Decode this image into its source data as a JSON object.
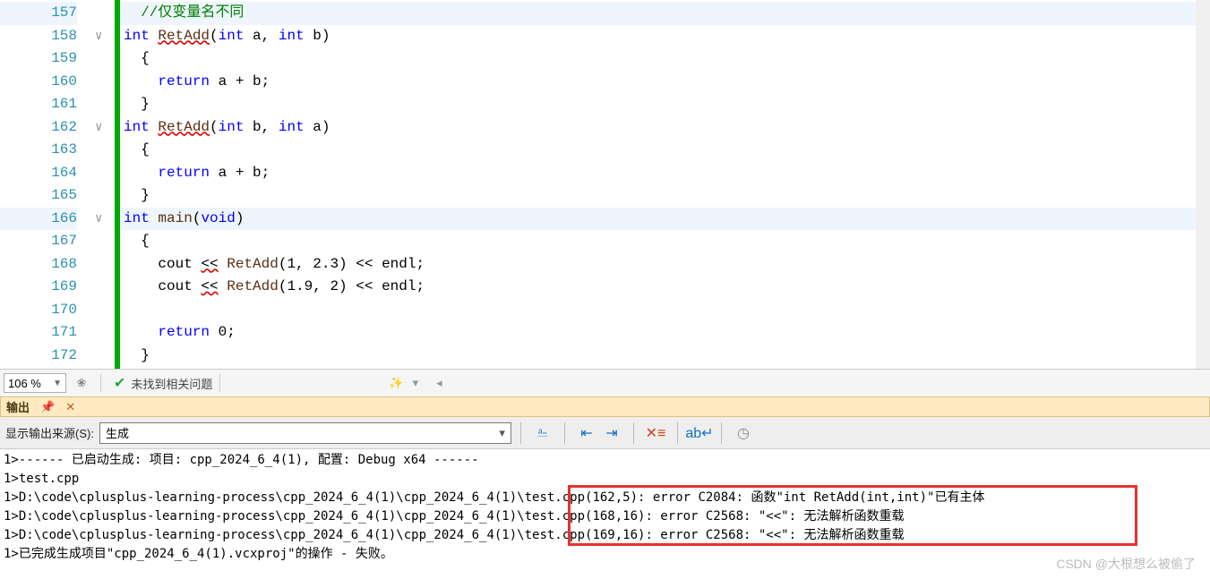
{
  "editor": {
    "lines": [
      {
        "num": 157,
        "hl": true,
        "fold": "",
        "tokens": [
          {
            "cls": "",
            "txt": "  "
          },
          {
            "cls": "cm",
            "txt": "//仅变量名不同"
          }
        ]
      },
      {
        "num": 158,
        "hl": false,
        "fold": "∨",
        "tokens": [
          {
            "cls": "kw",
            "txt": "int"
          },
          {
            "cls": "",
            "txt": " "
          },
          {
            "cls": "fn squig",
            "txt": "RetAdd"
          },
          {
            "cls": "",
            "txt": "("
          },
          {
            "cls": "kw",
            "txt": "int"
          },
          {
            "cls": "",
            "txt": " a, "
          },
          {
            "cls": "kw",
            "txt": "int"
          },
          {
            "cls": "",
            "txt": " b)"
          }
        ]
      },
      {
        "num": 159,
        "hl": false,
        "fold": "",
        "tokens": [
          {
            "cls": "",
            "txt": "  {"
          }
        ]
      },
      {
        "num": 160,
        "hl": false,
        "fold": "",
        "tokens": [
          {
            "cls": "",
            "txt": "    "
          },
          {
            "cls": "kw",
            "txt": "return"
          },
          {
            "cls": "",
            "txt": " a + b;"
          }
        ]
      },
      {
        "num": 161,
        "hl": false,
        "fold": "",
        "tokens": [
          {
            "cls": "",
            "txt": "  }"
          }
        ]
      },
      {
        "num": 162,
        "hl": false,
        "fold": "∨",
        "tokens": [
          {
            "cls": "kw",
            "txt": "int"
          },
          {
            "cls": "",
            "txt": " "
          },
          {
            "cls": "fn squig",
            "txt": "RetAdd"
          },
          {
            "cls": "",
            "txt": "("
          },
          {
            "cls": "kw",
            "txt": "int"
          },
          {
            "cls": "",
            "txt": " b, "
          },
          {
            "cls": "kw",
            "txt": "int"
          },
          {
            "cls": "",
            "txt": " a)"
          }
        ]
      },
      {
        "num": 163,
        "hl": false,
        "fold": "",
        "tokens": [
          {
            "cls": "",
            "txt": "  {"
          }
        ]
      },
      {
        "num": 164,
        "hl": false,
        "fold": "",
        "tokens": [
          {
            "cls": "",
            "txt": "    "
          },
          {
            "cls": "kw",
            "txt": "return"
          },
          {
            "cls": "",
            "txt": " a + b;"
          }
        ]
      },
      {
        "num": 165,
        "hl": false,
        "fold": "",
        "tokens": [
          {
            "cls": "",
            "txt": "  }"
          }
        ]
      },
      {
        "num": 166,
        "hl": true,
        "fold": "∨",
        "tokens": [
          {
            "cls": "kw",
            "txt": "int"
          },
          {
            "cls": "",
            "txt": " "
          },
          {
            "cls": "fn",
            "txt": "main"
          },
          {
            "cls": "",
            "txt": "("
          },
          {
            "cls": "kw",
            "txt": "void"
          },
          {
            "cls": "",
            "txt": ")"
          }
        ]
      },
      {
        "num": 167,
        "hl": false,
        "fold": "",
        "tokens": [
          {
            "cls": "",
            "txt": "  {"
          }
        ]
      },
      {
        "num": 168,
        "hl": false,
        "fold": "",
        "tokens": [
          {
            "cls": "",
            "txt": "    cout "
          },
          {
            "cls": "squig",
            "txt": "<<"
          },
          {
            "cls": "",
            "txt": " "
          },
          {
            "cls": "fn",
            "txt": "RetAdd"
          },
          {
            "cls": "",
            "txt": "(1, 2.3) << endl;"
          }
        ]
      },
      {
        "num": 169,
        "hl": false,
        "fold": "",
        "tokens": [
          {
            "cls": "",
            "txt": "    cout "
          },
          {
            "cls": "squig",
            "txt": "<<"
          },
          {
            "cls": "",
            "txt": " "
          },
          {
            "cls": "fn",
            "txt": "RetAdd"
          },
          {
            "cls": "",
            "txt": "(1.9, 2) << endl;"
          }
        ]
      },
      {
        "num": 170,
        "hl": false,
        "fold": "",
        "tokens": [
          {
            "cls": "",
            "txt": ""
          }
        ]
      },
      {
        "num": 171,
        "hl": false,
        "fold": "",
        "tokens": [
          {
            "cls": "",
            "txt": "    "
          },
          {
            "cls": "kw",
            "txt": "return"
          },
          {
            "cls": "",
            "txt": " 0;"
          }
        ]
      },
      {
        "num": 172,
        "hl": false,
        "fold": "",
        "tokens": [
          {
            "cls": "",
            "txt": "  }"
          }
        ]
      }
    ]
  },
  "status": {
    "zoom": "106 %",
    "no_issues": "未找到相关问题"
  },
  "output": {
    "panel_title": "输出",
    "source_label": "显示输出来源(S):",
    "source_value": "生成",
    "lines": [
      "1>------ 已启动生成: 项目: cpp_2024_6_4(1), 配置: Debug x64 ------",
      "1>test.cpp",
      "1>D:\\code\\cplusplus-learning-process\\cpp_2024_6_4(1)\\cpp_2024_6_4(1)\\test.cpp(162,5): error C2084: 函数\"int RetAdd(int,int)\"已有主体",
      "1>D:\\code\\cplusplus-learning-process\\cpp_2024_6_4(1)\\cpp_2024_6_4(1)\\test.cpp(168,16): error C2568: \"<<\": 无法解析函数重载",
      "1>D:\\code\\cplusplus-learning-process\\cpp_2024_6_4(1)\\cpp_2024_6_4(1)\\test.cpp(169,16): error C2568: \"<<\": 无法解析函数重载",
      "1>已完成生成项目\"cpp_2024_6_4(1).vcxproj\"的操作 - 失败。"
    ]
  },
  "watermark": "CSDN @大根想么被偷了"
}
